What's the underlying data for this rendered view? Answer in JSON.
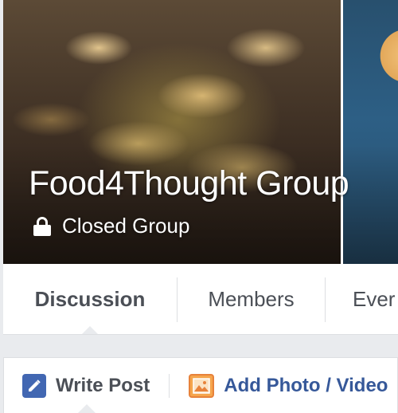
{
  "group": {
    "name": "Food4Thought Group",
    "privacy": "Closed Group"
  },
  "tabs": [
    {
      "label": "Discussion",
      "active": true
    },
    {
      "label": "Members",
      "active": false
    },
    {
      "label": "Ever",
      "active": false
    }
  ],
  "composer": {
    "write_post": "Write Post",
    "add_photo_video": "Add Photo / Video"
  },
  "icons": {
    "lock": "lock-icon",
    "pencil": "pencil-icon",
    "photo": "photo-icon"
  },
  "colors": {
    "link_blue": "#365899",
    "pencil_bg": "#4267b2",
    "photo_bg": "#f5a54c",
    "page_bg": "#e9ebee"
  }
}
